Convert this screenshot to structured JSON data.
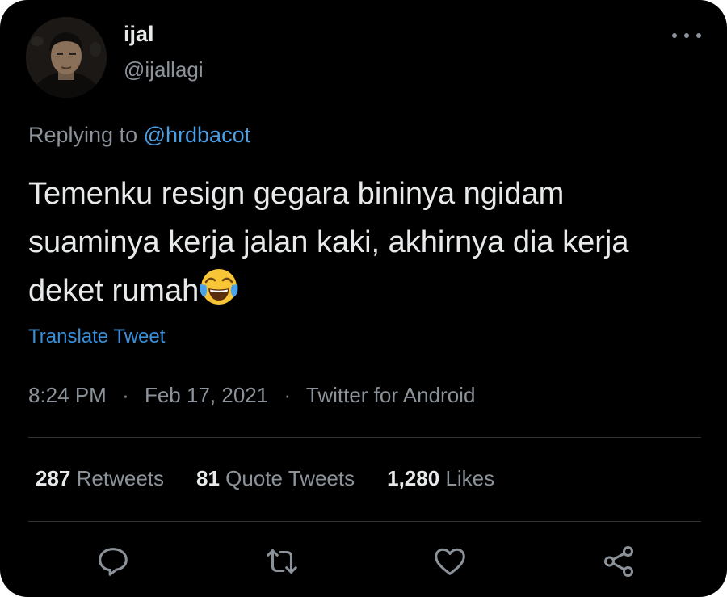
{
  "tweet": {
    "author": {
      "display_name": "ijal",
      "handle": "@ijallagi"
    },
    "reply": {
      "prefix": "Replying to",
      "mention": "@hrdbacot"
    },
    "text": "Temenku resign gegara bininya ngidam suaminya kerja jalan kaki, akhirnya dia kerja deket rumah",
    "emoji": "face-with-tears-of-joy",
    "translate_label": "Translate Tweet",
    "time": "8:24 PM",
    "separator": "·",
    "date": "Feb 17, 2021",
    "source": "Twitter for Android"
  },
  "stats": {
    "retweets": {
      "count": "287",
      "label": "Retweets"
    },
    "quote_tweets": {
      "count": "81",
      "label": "Quote Tweets"
    },
    "likes": {
      "count": "1,280",
      "label": "Likes"
    }
  },
  "actions": {
    "icons": [
      "reply-icon",
      "retweet-icon",
      "like-icon",
      "share-icon"
    ]
  },
  "colors": {
    "background": "#000000",
    "text": "#e7e9ea",
    "secondary": "#8b9299",
    "link": "#4a9fe5",
    "divider": "#2f3336"
  }
}
